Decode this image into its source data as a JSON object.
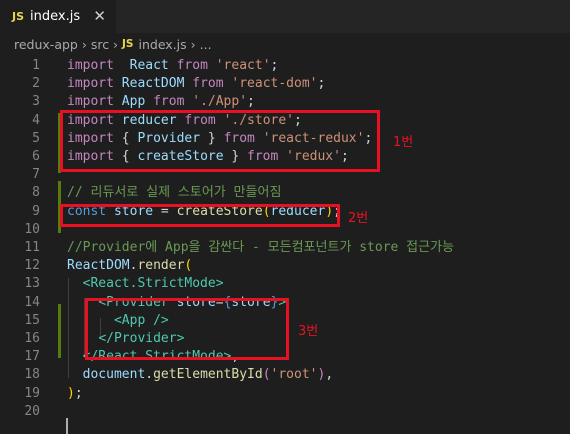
{
  "tab": {
    "js_badge": "JS",
    "filename": "index.js",
    "close_symbol": "✕"
  },
  "breadcrumb": {
    "folder1": "redux-app",
    "sep": " › ",
    "folder2": "src",
    "js_badge": "JS",
    "file": "index.js",
    "more": "..."
  },
  "lines": [
    {
      "n": "1",
      "tokens": [
        [
          "kw2",
          "import"
        ],
        [
          "",
          "  "
        ],
        [
          "var",
          "React"
        ],
        [
          "",
          " "
        ],
        [
          "kw2",
          "from"
        ],
        [
          "",
          " "
        ],
        [
          "str",
          "'react'"
        ],
        [
          "",
          ";"
        ]
      ]
    },
    {
      "n": "2",
      "tokens": [
        [
          "kw2",
          "import"
        ],
        [
          "",
          " "
        ],
        [
          "var",
          "ReactDOM"
        ],
        [
          "",
          " "
        ],
        [
          "kw2",
          "from"
        ],
        [
          "",
          " "
        ],
        [
          "str",
          "'react-dom'"
        ],
        [
          "",
          ";"
        ]
      ]
    },
    {
      "n": "3",
      "tokens": [
        [
          "kw2",
          "import"
        ],
        [
          "",
          " "
        ],
        [
          "var",
          "App"
        ],
        [
          "",
          " "
        ],
        [
          "kw2",
          "from"
        ],
        [
          "",
          " "
        ],
        [
          "str",
          "'./App'"
        ],
        [
          "",
          ";"
        ]
      ]
    },
    {
      "n": "4",
      "tokens": [
        [
          "kw2",
          "import"
        ],
        [
          "",
          " "
        ],
        [
          "var",
          "reducer"
        ],
        [
          "",
          " "
        ],
        [
          "kw2",
          "from"
        ],
        [
          "",
          " "
        ],
        [
          "str",
          "'./store'"
        ],
        [
          "",
          ";"
        ]
      ]
    },
    {
      "n": "5",
      "tokens": [
        [
          "kw2",
          "import"
        ],
        [
          "",
          " { "
        ],
        [
          "var",
          "Provider"
        ],
        [
          "",
          " } "
        ],
        [
          "kw2",
          "from"
        ],
        [
          "",
          " "
        ],
        [
          "str",
          "'react-redux'"
        ],
        [
          "",
          ";"
        ]
      ]
    },
    {
      "n": "6",
      "tokens": [
        [
          "kw2",
          "import"
        ],
        [
          "",
          " { "
        ],
        [
          "var",
          "createStore"
        ],
        [
          "",
          " } "
        ],
        [
          "kw2",
          "from"
        ],
        [
          "",
          " "
        ],
        [
          "str",
          "'redux'"
        ],
        [
          "",
          ";"
        ]
      ]
    },
    {
      "n": "7",
      "tokens": []
    },
    {
      "n": "8",
      "tokens": [
        [
          "cm",
          "// 리듀서로 실제 스토어가 만들어짐"
        ]
      ]
    },
    {
      "n": "9",
      "tokens": [
        [
          "kw",
          "const"
        ],
        [
          "",
          " "
        ],
        [
          "var",
          "store"
        ],
        [
          "",
          " = "
        ],
        [
          "fn",
          "createStore"
        ],
        [
          "br",
          "("
        ],
        [
          "var",
          "reducer"
        ],
        [
          "br",
          ")"
        ],
        [
          "",
          ";"
        ]
      ]
    },
    {
      "n": "10",
      "tokens": []
    },
    {
      "n": "11",
      "tokens": [
        [
          "cm",
          "//Provider에 App을 감싼다 - 모든컴포넌트가 store 접근가능"
        ]
      ]
    },
    {
      "n": "12",
      "tokens": [
        [
          "var",
          "ReactDOM"
        ],
        [
          "",
          "."
        ],
        [
          "fn",
          "render"
        ],
        [
          "br",
          "("
        ]
      ]
    },
    {
      "n": "13",
      "tokens": [
        [
          "",
          "  "
        ],
        [
          "tag",
          "<React.StrictMode"
        ],
        [
          "tag",
          ">"
        ]
      ]
    },
    {
      "n": "14",
      "tokens": [
        [
          "",
          "    "
        ],
        [
          "tag",
          "<Provider"
        ],
        [
          "",
          " "
        ],
        [
          "var",
          "store"
        ],
        [
          "",
          "="
        ],
        [
          "kw",
          "{"
        ],
        [
          "var",
          "store"
        ],
        [
          "kw",
          "}"
        ],
        [
          "tag",
          ">"
        ]
      ]
    },
    {
      "n": "15",
      "tokens": [
        [
          "",
          "      "
        ],
        [
          "tag",
          "<App"
        ],
        [
          "",
          " "
        ],
        [
          "tag",
          "/>"
        ]
      ]
    },
    {
      "n": "16",
      "tokens": [
        [
          "",
          "    "
        ],
        [
          "tag",
          "</Provider>"
        ]
      ]
    },
    {
      "n": "17",
      "tokens": [
        [
          "",
          "  "
        ],
        [
          "tag",
          "</React.StrictMode>"
        ],
        [
          "",
          ","
        ]
      ]
    },
    {
      "n": "18",
      "tokens": [
        [
          "",
          "  "
        ],
        [
          "var",
          "document"
        ],
        [
          "",
          "."
        ],
        [
          "fn",
          "getElementById"
        ],
        [
          "kw2",
          "("
        ],
        [
          "str",
          "'root'"
        ],
        [
          "kw2",
          ")"
        ],
        [
          "",
          ","
        ]
      ]
    },
    {
      "n": "19",
      "tokens": [
        [
          "br",
          ")"
        ],
        [
          "",
          ";"
        ]
      ]
    },
    {
      "n": "20",
      "tokens": []
    }
  ],
  "annotations": {
    "box1": "1번",
    "box2": "2번",
    "box3": "3번"
  },
  "colors": {
    "annotation": "#e81123",
    "editor_bg": "#1e1e1e",
    "modified_gutter": "#587c0c"
  }
}
